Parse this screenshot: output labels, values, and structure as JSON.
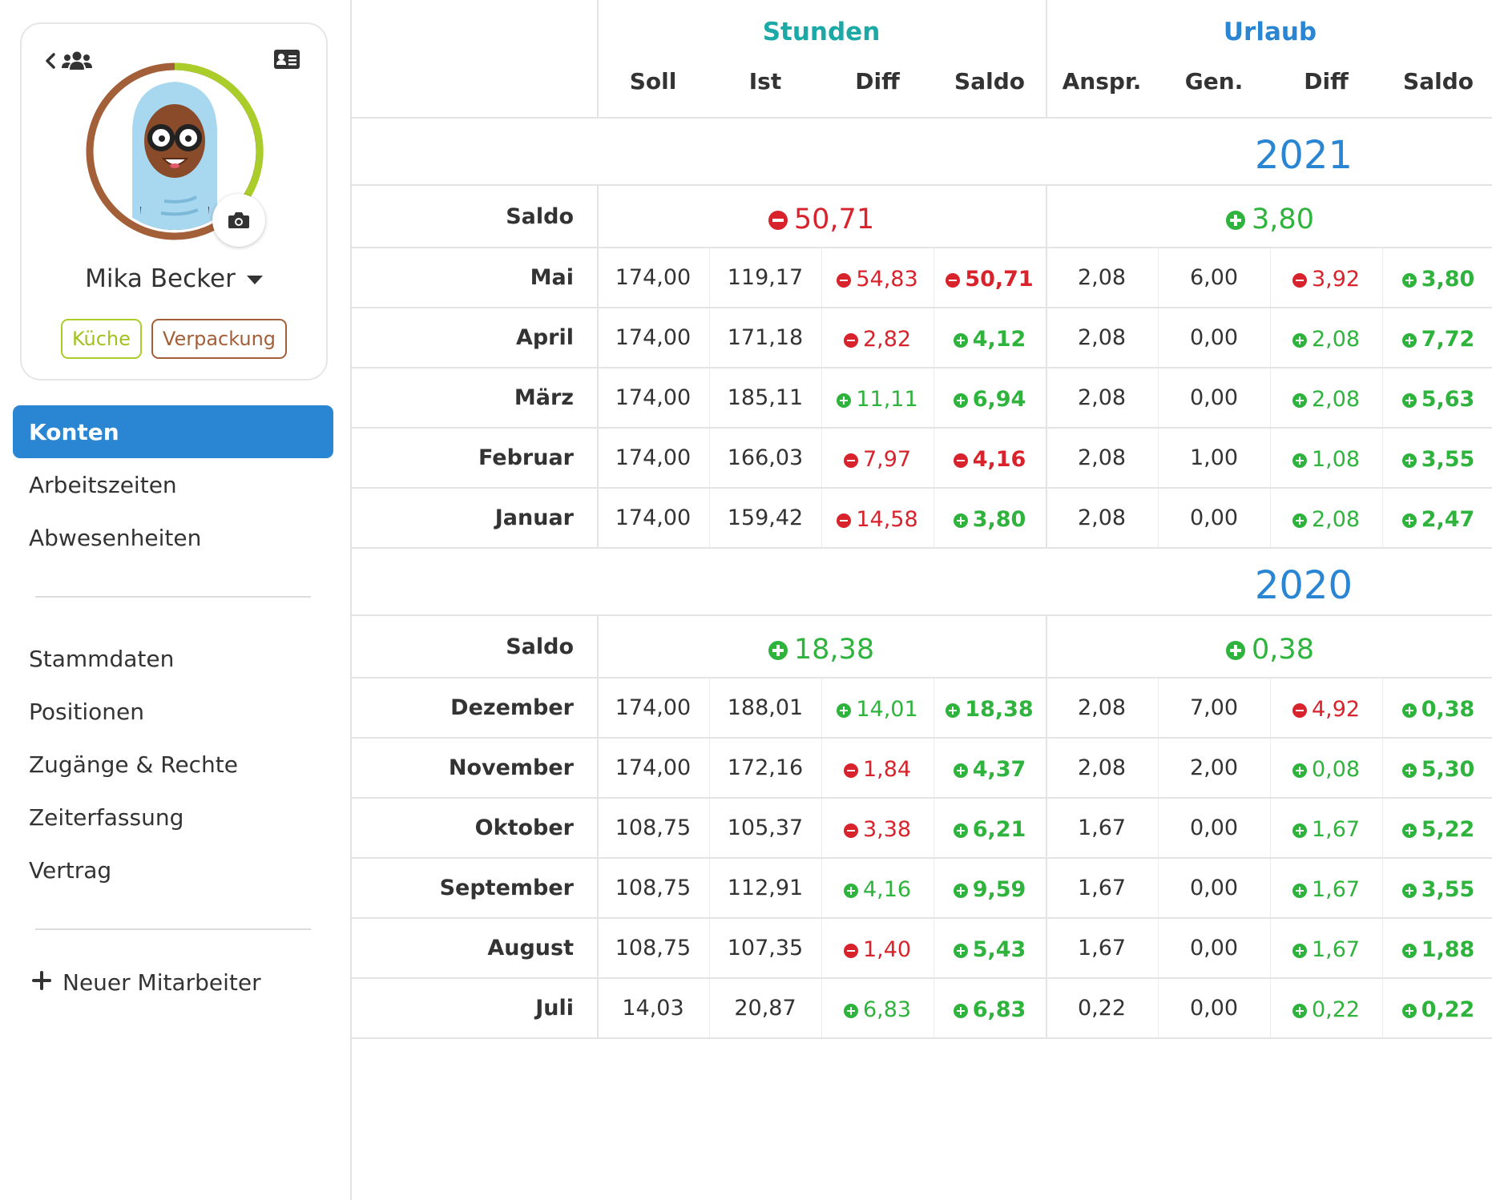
{
  "profile": {
    "name": "Mika Becker",
    "tags": [
      "Küche",
      "Verpackung"
    ]
  },
  "nav": {
    "primary": [
      "Konten",
      "Arbeitszeiten",
      "Abwesenheiten"
    ],
    "secondary": [
      "Stammdaten",
      "Positionen",
      "Zugänge & Rechte",
      "Zeiterfassung",
      "Vertrag"
    ],
    "new_employee": "Neuer Mitarbeiter"
  },
  "table": {
    "groups": {
      "hours": "Stunden",
      "vacation": "Urlaub"
    },
    "columns": [
      "Soll",
      "Ist",
      "Diff",
      "Saldo",
      "Anspr.",
      "Gen.",
      "Diff",
      "Saldo"
    ],
    "saldo_label": "Saldo",
    "years": [
      {
        "year": "2021",
        "saldo_hours": "50,71",
        "saldo_hours_sign": "neg",
        "saldo_vacation": "3,80",
        "saldo_vacation_sign": "pos",
        "months": [
          {
            "m": "Mai",
            "soll": "174,00",
            "ist": "119,17",
            "diff": "54,83",
            "diff_s": "neg",
            "saldo": "50,71",
            "saldo_s": "neg",
            "anspr": "2,08",
            "gen": "6,00",
            "udiff": "3,92",
            "udiff_s": "neg",
            "usaldo": "3,80",
            "usaldo_s": "pos"
          },
          {
            "m": "April",
            "soll": "174,00",
            "ist": "171,18",
            "diff": "2,82",
            "diff_s": "neg",
            "saldo": "4,12",
            "saldo_s": "pos",
            "anspr": "2,08",
            "gen": "0,00",
            "udiff": "2,08",
            "udiff_s": "pos",
            "usaldo": "7,72",
            "usaldo_s": "pos"
          },
          {
            "m": "März",
            "soll": "174,00",
            "ist": "185,11",
            "diff": "11,11",
            "diff_s": "pos",
            "saldo": "6,94",
            "saldo_s": "pos",
            "anspr": "2,08",
            "gen": "0,00",
            "udiff": "2,08",
            "udiff_s": "pos",
            "usaldo": "5,63",
            "usaldo_s": "pos"
          },
          {
            "m": "Februar",
            "soll": "174,00",
            "ist": "166,03",
            "diff": "7,97",
            "diff_s": "neg",
            "saldo": "4,16",
            "saldo_s": "neg",
            "anspr": "2,08",
            "gen": "1,00",
            "udiff": "1,08",
            "udiff_s": "pos",
            "usaldo": "3,55",
            "usaldo_s": "pos"
          },
          {
            "m": "Januar",
            "soll": "174,00",
            "ist": "159,42",
            "diff": "14,58",
            "diff_s": "neg",
            "saldo": "3,80",
            "saldo_s": "pos",
            "anspr": "2,08",
            "gen": "0,00",
            "udiff": "2,08",
            "udiff_s": "pos",
            "usaldo": "2,47",
            "usaldo_s": "pos"
          }
        ]
      },
      {
        "year": "2020",
        "saldo_hours": "18,38",
        "saldo_hours_sign": "pos",
        "saldo_vacation": "0,38",
        "saldo_vacation_sign": "pos",
        "months": [
          {
            "m": "Dezember",
            "soll": "174,00",
            "ist": "188,01",
            "diff": "14,01",
            "diff_s": "pos",
            "saldo": "18,38",
            "saldo_s": "pos",
            "anspr": "2,08",
            "gen": "7,00",
            "udiff": "4,92",
            "udiff_s": "neg",
            "usaldo": "0,38",
            "usaldo_s": "pos"
          },
          {
            "m": "November",
            "soll": "174,00",
            "ist": "172,16",
            "diff": "1,84",
            "diff_s": "neg",
            "saldo": "4,37",
            "saldo_s": "pos",
            "anspr": "2,08",
            "gen": "2,00",
            "udiff": "0,08",
            "udiff_s": "pos",
            "usaldo": "5,30",
            "usaldo_s": "pos"
          },
          {
            "m": "Oktober",
            "soll": "108,75",
            "ist": "105,37",
            "diff": "3,38",
            "diff_s": "neg",
            "saldo": "6,21",
            "saldo_s": "pos",
            "anspr": "1,67",
            "gen": "0,00",
            "udiff": "1,67",
            "udiff_s": "pos",
            "usaldo": "5,22",
            "usaldo_s": "pos"
          },
          {
            "m": "September",
            "soll": "108,75",
            "ist": "112,91",
            "diff": "4,16",
            "diff_s": "pos",
            "saldo": "9,59",
            "saldo_s": "pos",
            "anspr": "1,67",
            "gen": "0,00",
            "udiff": "1,67",
            "udiff_s": "pos",
            "usaldo": "3,55",
            "usaldo_s": "pos"
          },
          {
            "m": "August",
            "soll": "108,75",
            "ist": "107,35",
            "diff": "1,40",
            "diff_s": "neg",
            "saldo": "5,43",
            "saldo_s": "pos",
            "anspr": "1,67",
            "gen": "0,00",
            "udiff": "1,67",
            "udiff_s": "pos",
            "usaldo": "1,88",
            "usaldo_s": "pos"
          },
          {
            "m": "Juli",
            "soll": "14,03",
            "ist": "20,87",
            "diff": "6,83",
            "diff_s": "pos",
            "saldo": "6,83",
            "saldo_s": "pos",
            "anspr": "0,22",
            "gen": "0,00",
            "udiff": "0,22",
            "udiff_s": "pos",
            "usaldo": "0,22",
            "usaldo_s": "pos"
          }
        ]
      }
    ]
  },
  "colors": {
    "accent": "#2a86d3",
    "positive": "#2eb33d",
    "negative": "#d8232c",
    "hours_group": "#1aa9a6",
    "tag_kueche": "#a0c21f",
    "tag_verpackung": "#a35f37"
  },
  "icons": [
    "chevron-left-icon",
    "users-icon",
    "id-card-icon",
    "camera-icon",
    "caret-down-icon",
    "plus-icon",
    "plus-circle-icon",
    "minus-circle-icon"
  ]
}
